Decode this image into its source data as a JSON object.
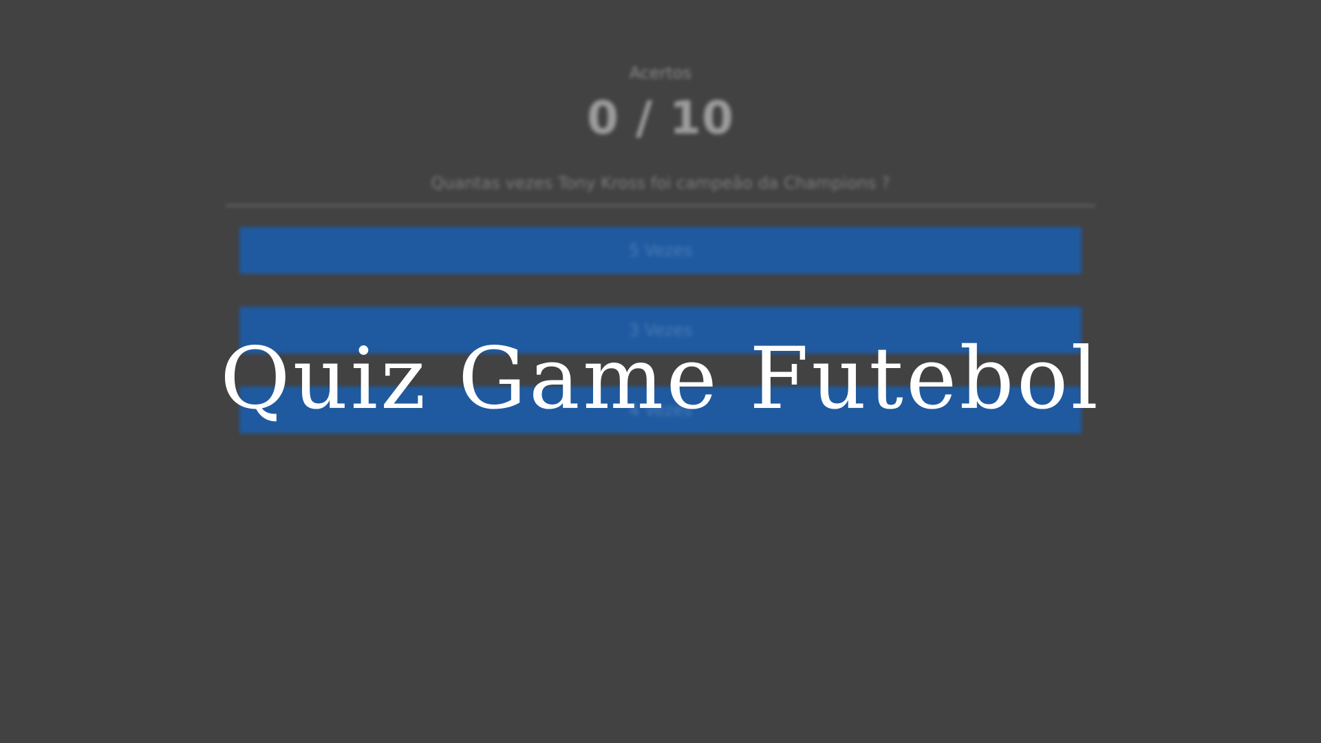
{
  "score": {
    "caption": "Acertos",
    "value": "0 / 10"
  },
  "question": {
    "text": "Quantas vezes Tony Kross foi campeão da Champions ?"
  },
  "answers": [
    {
      "label": "5 Vezes"
    },
    {
      "label": "3 Vezes"
    },
    {
      "label": "4 Vezes"
    }
  ],
  "overlay": {
    "title": "Quiz Game Futebol"
  },
  "colors": {
    "background": "#424242",
    "answer_button": "#1f5aa0",
    "title_text": "#ffffff"
  }
}
